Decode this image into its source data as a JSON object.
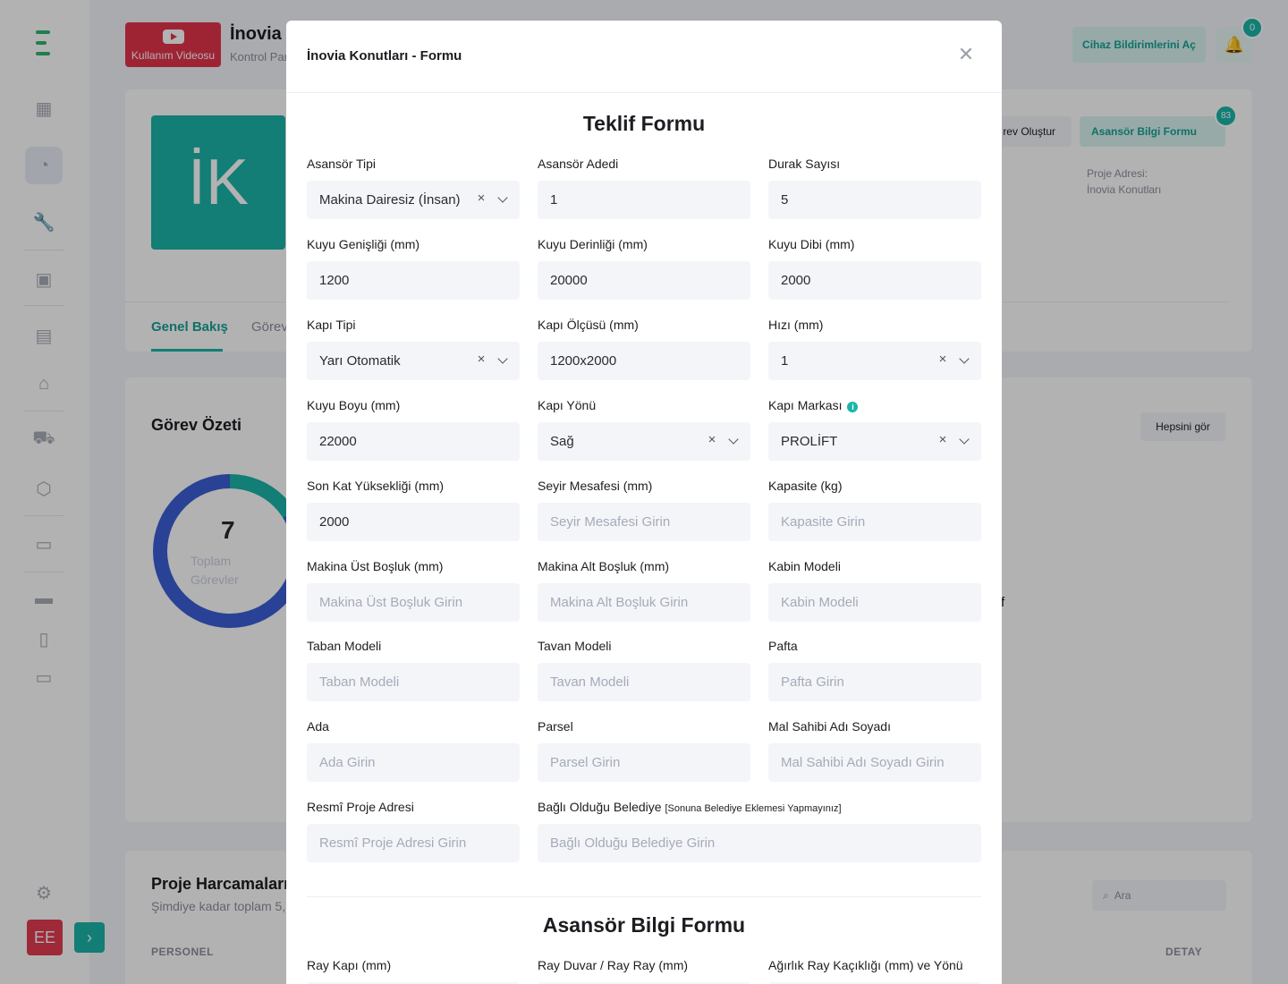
{
  "background": {
    "video_button": "Kullanım Videosu",
    "project_title": "İnovia K",
    "project_subtitle": "Kontrol Par",
    "notifications_button": "Cihaz Bildirimlerini Aç",
    "notification_count": "0",
    "avatar_initials": "İK",
    "create_task_button": "rev Oluştur",
    "elevator_info_button": "Asansör Bilgi Formu",
    "elevator_info_count": "83",
    "project_address_label": "Proje Adresi:",
    "project_address_value": "İnovia Konutları",
    "tab_overview": "Genel Bakış",
    "tab_tasks": "Görev",
    "task_summary_title": "Görev Özeti",
    "see_all_button": "Hepsini gör",
    "total_tasks": "7",
    "total_tasks_label_1": "Toplam",
    "total_tasks_label_2": "Görevler",
    "stray_char": "f",
    "expenses_title": "Proje Harcamaları",
    "expenses_subtitle": "Şimdiye kadar toplam 5,",
    "search_placeholder": "Ara",
    "col_personnel": "PERSONEL",
    "col_detail": "DETAY",
    "user_initials": "EE"
  },
  "modal": {
    "title": "İnovia Konutları - Formu",
    "section1_title": "Teklif Formu",
    "section2_title": "Asansör Bilgi Formu",
    "fields": {
      "asansor_tipi": {
        "label": "Asansör Tipi",
        "value": "Makina Dairesiz (İnsan)"
      },
      "asansor_adedi": {
        "label": "Asansör Adedi",
        "value": "1"
      },
      "durak_sayisi": {
        "label": "Durak Sayısı",
        "value": "5"
      },
      "kuyu_genisligi": {
        "label": "Kuyu Genişliği (mm)",
        "value": "1200"
      },
      "kuyu_derinligi": {
        "label": "Kuyu Derinliği (mm)",
        "value": "20000"
      },
      "kuyu_dibi": {
        "label": "Kuyu Dibi (mm)",
        "value": "2000"
      },
      "kapi_tipi": {
        "label": "Kapı Tipi",
        "value": "Yarı Otomatik"
      },
      "kapi_olcusu": {
        "label": "Kapı Ölçüsü (mm)",
        "value": "1200x2000"
      },
      "hizi": {
        "label": "Hızı (mm)",
        "value": "1"
      },
      "kuyu_boyu": {
        "label": "Kuyu Boyu (mm)",
        "value": "22000"
      },
      "kapi_yonu": {
        "label": "Kapı Yönü",
        "value": "Sağ"
      },
      "kapi_markasi": {
        "label": "Kapı Markası",
        "value": "PROLİFT"
      },
      "son_kat": {
        "label": "Son Kat Yüksekliği (mm)",
        "value": "2000"
      },
      "seyir_mesafesi": {
        "label": "Seyir Mesafesi (mm)",
        "placeholder": "Seyir Mesafesi Girin"
      },
      "kapasite": {
        "label": "Kapasite (kg)",
        "placeholder": "Kapasite Girin"
      },
      "makina_ust": {
        "label": "Makina Üst Boşluk (mm)",
        "placeholder": "Makina Üst Boşluk Girin"
      },
      "makina_alt": {
        "label": "Makina Alt Boşluk (mm)",
        "placeholder": "Makina Alt Boşluk Girin"
      },
      "kabin_modeli": {
        "label": "Kabin Modeli",
        "placeholder": "Kabin Modeli"
      },
      "taban_modeli": {
        "label": "Taban Modeli",
        "placeholder": "Taban Modeli"
      },
      "tavan_modeli": {
        "label": "Tavan Modeli",
        "placeholder": "Tavan Modeli"
      },
      "pafta": {
        "label": "Pafta",
        "placeholder": "Pafta Girin"
      },
      "ada": {
        "label": "Ada",
        "placeholder": "Ada Girin"
      },
      "parsel": {
        "label": "Parsel",
        "placeholder": "Parsel Girin"
      },
      "mal_sahibi": {
        "label": "Mal Sahibi Adı Soyadı",
        "placeholder": "Mal Sahibi Adı Soyadı Girin"
      },
      "resmi_adres": {
        "label": "Resmî Proje Adresi",
        "placeholder": "Resmî Proje Adresi Girin"
      },
      "belediye": {
        "label": "Bağlı Olduğu Belediye",
        "note": "[Sonuna Belediye Eklemesi Yapmayınız]",
        "placeholder": "Bağlı Olduğu Belediye Girin"
      },
      "ray_kapi": {
        "label": "Ray Kapı (mm)"
      },
      "ray_duvar": {
        "label": "Ray Duvar / Ray Ray (mm)"
      },
      "agirlik_ray": {
        "label": "Ağırlık Ray Kaçıklığı (mm) ve Yönü"
      }
    }
  },
  "colors": {
    "accent": "#1bb5a8",
    "danger": "#e2344b",
    "input_bg": "#f3f5f9"
  }
}
